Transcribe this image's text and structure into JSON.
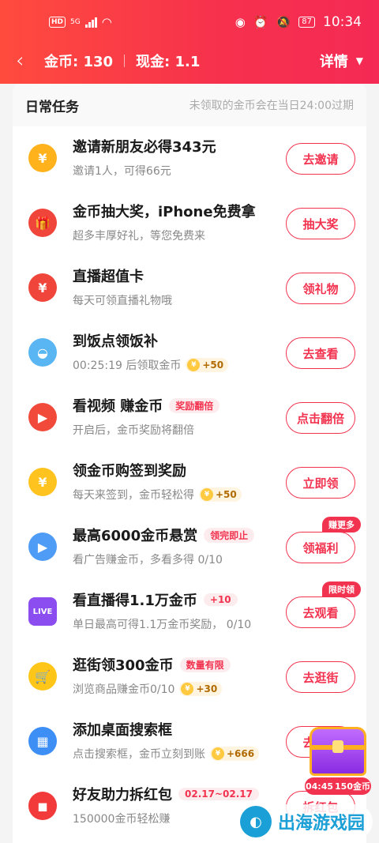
{
  "status": {
    "hd": "HD",
    "signal": "5G",
    "battery": "87",
    "time": "10:34"
  },
  "nav": {
    "coins": "金币: 130",
    "cash": "现金: 1.1",
    "detail": "详情"
  },
  "section": {
    "title": "日常任务",
    "note": "未领取的金币会在当日24:00过期"
  },
  "tasks": [
    {
      "title": "邀请新朋友必得343元",
      "sub": "邀请1人，可得66元",
      "button": "去邀请",
      "icon": "yuan-coin-icon",
      "color": "#ffb21c",
      "glyph": "¥"
    },
    {
      "title": "金币抽大奖，iPhone免费拿",
      "sub": "超多丰厚好礼，等您免费来",
      "button": "抽大奖",
      "icon": "gift-icon",
      "color": "#f0453a",
      "glyph": "🎁"
    },
    {
      "title": "直播超值卡",
      "sub": "每天可领直播礼物哦",
      "button": "领礼物",
      "icon": "gift-card-icon",
      "color": "#f0453a",
      "glyph": "¥"
    },
    {
      "title": "到饭点领饭补",
      "sub": "00:25:19 后领取金币",
      "coin": "+50",
      "button": "去查看",
      "icon": "rice-bowl-icon",
      "color": "#59b6f2",
      "glyph": "◒"
    },
    {
      "title": "看视频 赚金币",
      "tag": "奖励翻倍",
      "sub": "开启后，金币奖励将翻倍",
      "button": "点击翻倍",
      "icon": "play-video-icon",
      "color": "#f24a3a",
      "glyph": "▶"
    },
    {
      "title": "领金币购签到奖励",
      "sub": "每天来签到，金币轻松得",
      "coin": "+50",
      "button": "立即领",
      "icon": "money-bag-icon",
      "color": "#ffc31f",
      "glyph": "¥"
    },
    {
      "title": "最高6000金币悬赏",
      "tag": "领完即止",
      "sub": "看广告赚金币，多看多得 0/10",
      "button": "领福利",
      "badge": "赚更多",
      "icon": "ad-play-icon",
      "color": "#4f9cf7",
      "glyph": "▶"
    },
    {
      "title": "看直播得1.1万金币",
      "tag": "+10",
      "sub": "单日最高可得1.1万金币奖励，  0/10",
      "button": "去观看",
      "badge": "限时领",
      "icon": "live-tv-icon",
      "color": "#8b4cf0",
      "glyph": "LIVE"
    },
    {
      "title": "逛街领300金币",
      "tag": "数量有限",
      "sub": "浏览商品赚金币0/10",
      "coin": "+30",
      "button": "去逛街",
      "icon": "shopping-cart-icon",
      "color": "#ffc61a",
      "glyph": "🛒"
    },
    {
      "title": "添加桌面搜索框",
      "sub": "点击搜索框，金币立刻到账",
      "coin": "+666",
      "button": "去添加",
      "icon": "app-grid-icon",
      "color": "#3d8ef5",
      "glyph": "▦"
    },
    {
      "title": "好友助力拆红包",
      "tag": "02.17~02.17",
      "sub": "150000金币轻松赚",
      "button": "拆红包",
      "icon": "red-envelope-icon",
      "color": "#f23a3a",
      "glyph": "◼"
    }
  ],
  "floating": {
    "timer": "04:45",
    "reward": "150金币"
  },
  "watermark": {
    "text": "出海游戏园"
  }
}
